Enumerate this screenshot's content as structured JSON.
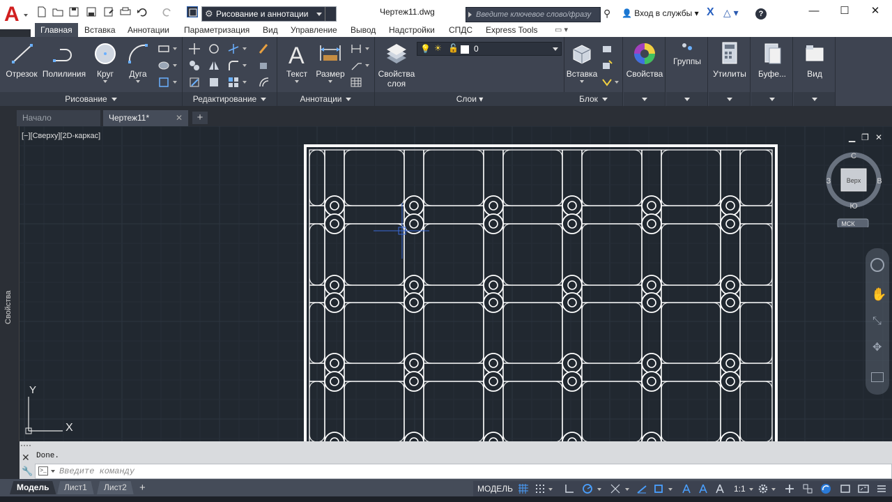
{
  "app": {
    "title": "Чертеж11.dwg",
    "workspace": "Рисование и аннотации",
    "search_placeholder": "Введите ключевое слово/фразу",
    "signin_label": "Вход в службы",
    "help_label": "?",
    "logo_letter": "A",
    "window": {
      "minimize": "—",
      "maximize": "☐",
      "close": "✕"
    }
  },
  "ribbon_tabs": [
    "Главная",
    "Вставка",
    "Аннотации",
    "Параметризация",
    "Вид",
    "Управление",
    "Вывод",
    "Надстройки",
    "СПДС",
    "Express Tools"
  ],
  "ribbon_extra": "▭ ▾",
  "ribbon": {
    "draw": {
      "title": "Рисование",
      "buttons": [
        "Отрезок",
        "Полилиния",
        "Круг",
        "Дуга"
      ]
    },
    "modify": {
      "title": "Редактирование"
    },
    "annotation": {
      "title": "Аннотации",
      "buttons": [
        "Текст",
        "Размер"
      ]
    },
    "layers": {
      "title": "Слои",
      "button": "Свойства слоя",
      "current_layer": "0"
    },
    "block": {
      "title": "Блок",
      "button": "Вставка"
    },
    "properties": {
      "button": "Свойства"
    },
    "groups": {
      "button": "Группы"
    },
    "utilities": {
      "button": "Утилиты"
    },
    "clipboard": {
      "button": "Буфе..."
    },
    "view": {
      "button": "Вид"
    }
  },
  "doc_tabs": {
    "start": "Начало",
    "current": "Чертеж11*",
    "close": "✕",
    "add": "+"
  },
  "viewport": {
    "label": "[−][Сверху][2D-каркас]",
    "side_palette": "Свойства",
    "controls": [
      "▁",
      "❐",
      "✕"
    ],
    "viewcube": {
      "north": "С",
      "south": "Ю",
      "west": "З",
      "east": "В",
      "face": "Верх",
      "ucs": "МСК"
    },
    "axis_y": "Y",
    "axis_x": "X"
  },
  "command": {
    "history": "Done.",
    "placeholder": "Введите команду",
    "prompt_icon": ">_"
  },
  "status": {
    "layout_tabs": [
      "Модель",
      "Лист1",
      "Лист2"
    ],
    "add_tab": "+",
    "model": "МОДЕЛЬ",
    "scale": "1:1"
  },
  "colors": {
    "canvas": "#212830",
    "ribbon": "#3e4451",
    "accent_red": "#d11f1f",
    "drawing_stroke": "#ffffff"
  }
}
